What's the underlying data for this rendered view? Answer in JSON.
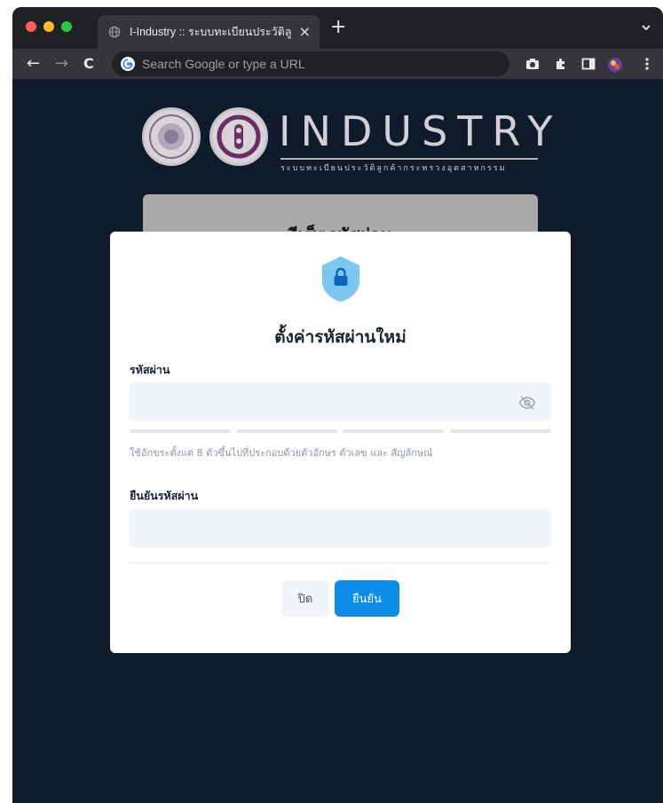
{
  "browser": {
    "tab_title": "I-Industry :: ระบบทะเบียนประวัติลูกค้ากระทรวงอุตสาหกรรม",
    "tab_close": "×",
    "new_tab": "+",
    "omnibox_placeholder": "Search Google or type a URL"
  },
  "header": {
    "brand": "INDUSTRY",
    "subtitle": "ระบบทะเบียนประวัติลูกค้ากระทรวงอุตสาหกรรม",
    "behind_card_title": "รีเซ็ตรหัสผ่าน"
  },
  "modal": {
    "title": "ตั้งค่ารหัสผ่านใหม่",
    "password_label": "รหัสผ่าน",
    "password_value": "",
    "hint": "ใช้อักขระตั้งแต่ 8 ตัวขึ้นไปที่ประกอบด้วยตัวอักษร ตัวเลข และ สัญลักษณ์",
    "confirm_label": "ยืนยันรหัสผ่าน",
    "confirm_value": "",
    "close_button": "ปิด",
    "confirm_button": "ยืนยัน"
  },
  "colors": {
    "page_background": "#0f1a2b",
    "accent": "#0b8de9",
    "shield": "#7cc7ef"
  }
}
